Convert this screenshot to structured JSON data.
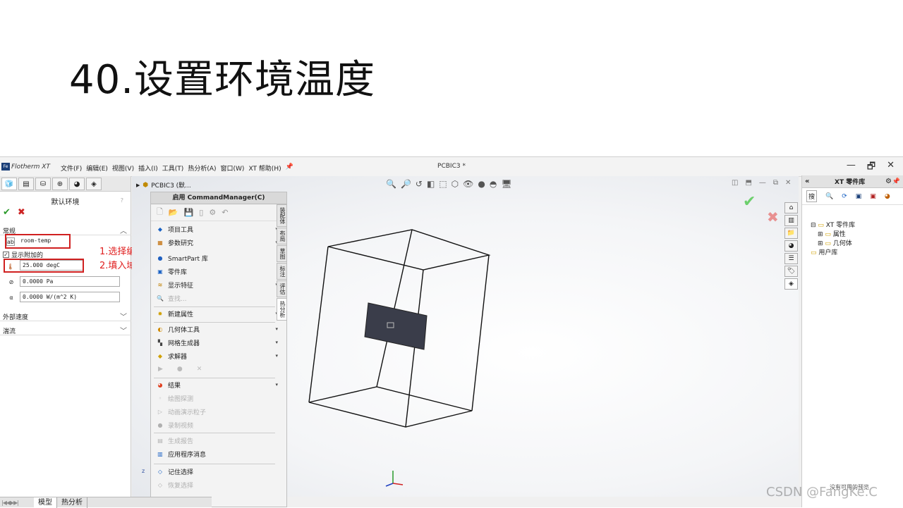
{
  "slide": {
    "title": "40.设置环境温度"
  },
  "app": {
    "logo_text": "Flotherm XT",
    "logo_badge": "Fe",
    "menus": [
      "文件(F)",
      "编辑(E)",
      "视图(V)",
      "插入(I)",
      "工具(T)",
      "热分析(A)",
      "窗口(W)",
      "XT 帮助(H)"
    ],
    "doc_title": "PCBIC3 *",
    "win_controls": {
      "minimize": "—",
      "restore": "🗗",
      "close": "✕"
    }
  },
  "left_panel": {
    "feature_title": "默认环境",
    "section_general": "常规",
    "name_value": "room-temp",
    "show_additional_label": "显示附加的",
    "temperature_value": "25.000 degC",
    "pressure_value": "0.0000 Pa",
    "htc_value": "0.0000 W/(m^2 K)",
    "section_external_velocity": "外部速度",
    "section_turbulence": "湍流",
    "help_mark": "?"
  },
  "annotations": {
    "step1": "1.选择编辑名称",
    "step2": "2.填入域环境温度"
  },
  "tree": {
    "root_label": "PCBIC3 (默..."
  },
  "command_manager": {
    "title": "启用 CommandManager(C)",
    "items": [
      {
        "label": "项目工具"
      },
      {
        "label": "参数研究"
      },
      {
        "label": "SmartPart 库"
      },
      {
        "label": "零件库"
      },
      {
        "label": "显示特征"
      },
      {
        "label": "查找..."
      },
      {
        "label": "新建属性"
      },
      {
        "label": "几何体工具"
      },
      {
        "label": "网格生成器"
      },
      {
        "label": "求解器"
      },
      {
        "label": "结果"
      },
      {
        "label": "绘图探测"
      },
      {
        "label": "动画演示粒子"
      },
      {
        "label": "录制视频"
      },
      {
        "label": "生成报告"
      },
      {
        "label": "应用程序消息"
      },
      {
        "label": "记住选择"
      },
      {
        "label": "恢复选择"
      }
    ],
    "vtabs": [
      "装配体",
      "布局",
      "草图",
      "标注",
      "评估",
      "热分析"
    ]
  },
  "bottom_tabs": {
    "model": "模型",
    "thermal": "热分析"
  },
  "right_panel": {
    "title": "XT 零件库",
    "search_tab": "搜",
    "tree_root": "XT 零件库",
    "tree_child1": "属性",
    "tree_child2": "几何体",
    "tree_user": "用户库",
    "bottom_text": "没有可用的预览"
  },
  "watermark": "CSDN @FangKe.C",
  "colors": {
    "annotation_red": "#e02020",
    "ok_green": "#2a9a2a",
    "cancel_red": "#cc2222",
    "part_fill": "#3a3d4a"
  }
}
